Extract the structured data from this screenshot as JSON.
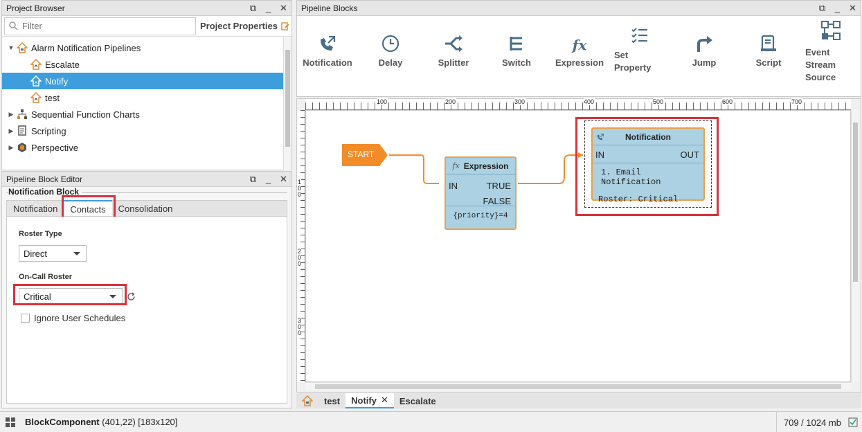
{
  "project_browser": {
    "title": "Project Browser",
    "filter_placeholder": "Filter",
    "project_properties": "Project Properties",
    "tree": [
      {
        "label": "Alarm Notification Pipelines",
        "level": 1,
        "expanded": true,
        "icon": "pipeline-folder-icon"
      },
      {
        "label": "Escalate",
        "level": 2,
        "icon": "pipeline-icon"
      },
      {
        "label": "Notify",
        "level": 2,
        "icon": "pipeline-icon",
        "selected": true
      },
      {
        "label": "test",
        "level": 2,
        "icon": "pipeline-icon"
      },
      {
        "label": "Sequential Function Charts",
        "level": 1,
        "icon": "sfc-icon"
      },
      {
        "label": "Scripting",
        "level": 1,
        "icon": "script-icon"
      },
      {
        "label": "Perspective",
        "level": 1,
        "icon": "perspective-icon"
      }
    ]
  },
  "block_editor": {
    "title": "Pipeline Block Editor",
    "section": "Notification Block",
    "tabs": [
      "Notification",
      "Contacts",
      "Consolidation"
    ],
    "active_tab": "Contacts",
    "roster_type_label": "Roster Type",
    "roster_type_value": "Direct",
    "on_call_label": "On-Call Roster",
    "on_call_value": "Critical",
    "ignore_schedules_label": "Ignore User Schedules"
  },
  "pipeline_blocks": {
    "title": "Pipeline Blocks",
    "tools": [
      {
        "label": "Notification",
        "icon": "notification-icon"
      },
      {
        "label": "Delay",
        "icon": "clock-icon"
      },
      {
        "label": "Splitter",
        "icon": "splitter-icon"
      },
      {
        "label": "Switch",
        "icon": "switch-icon"
      },
      {
        "label": "Expression",
        "icon": "fx-icon"
      },
      {
        "label": "Set\nProperty",
        "icon": "set-property-icon"
      },
      {
        "label": "Jump",
        "icon": "jump-icon"
      },
      {
        "label": "Script",
        "icon": "script-icon"
      },
      {
        "label": "Event\nStream\nSource",
        "icon": "event-stream-icon"
      }
    ]
  },
  "canvas": {
    "ruler_top": [
      "100",
      "200",
      "300",
      "400",
      "500",
      "600",
      "700"
    ],
    "ruler_left": [
      "1\n0\n0",
      "2\n0\n0",
      "3\n0\n0"
    ],
    "start_label": "START",
    "expression_block": {
      "title": "Expression",
      "in": "IN",
      "true": "TRUE",
      "false": "FALSE",
      "expr": "{priority}=4"
    },
    "notification_block": {
      "title": "Notification",
      "in": "IN",
      "out": "OUT",
      "line1": "1. Email Notification",
      "line2": "Roster: Critical"
    }
  },
  "doc_tabs": [
    {
      "label": "test"
    },
    {
      "label": "Notify",
      "active": true,
      "closable": true
    },
    {
      "label": "Escalate"
    }
  ],
  "status": {
    "component": "BlockComponent",
    "coords": "(401,22) [183x120]",
    "memory": "709 / 1024 mb"
  },
  "colors": {
    "selection": "#3d9ddd",
    "block_fill": "#abd1e3",
    "block_border": "#e8a04c",
    "start": "#f28c28",
    "highlight": "#d8323c"
  }
}
